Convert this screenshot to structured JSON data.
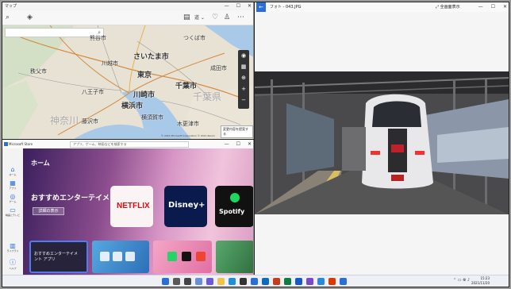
{
  "maps": {
    "title": "マップ",
    "search_icon": "search-icon",
    "labels": {
      "saitama": "さいたま市",
      "tokyo": "東京",
      "chiba": "千葉市",
      "kawasaki": "川崎市",
      "yokohama": "横浜市",
      "chiba_pref": "千葉県",
      "kanagawa": "神奈川",
      "hachioji": "八王子市",
      "chichibu": "秩父市",
      "kumagaya": "熊谷市",
      "tsukuba": "つくば市",
      "narita": "成田市",
      "kisarazu": "木更津市",
      "yokosuka": "横須賀市",
      "fujisawa": "藤沢市",
      "kawagoe": "川越市"
    },
    "feedback_label": "変更内容を提案する",
    "copyright": "© 2021 Microsoft Corporation © 2021 Zenrin"
  },
  "store": {
    "title": "Microsoft Store",
    "search_placeholder": "アプリ、ゲーム、映画などを検索する",
    "nav": {
      "home": "ホーム",
      "apps": "アプリ",
      "games": "ゲーム",
      "movies": "映画とテレビ",
      "library": "ライブラリ",
      "help": "ヘルプ"
    },
    "hero": {
      "home_label": "ホーム",
      "title": "おすすめエンターテイメント アプリ",
      "button": "詳細の表示"
    },
    "tiles": {
      "netflix": "NETFLIX",
      "disney": "Disney+",
      "spotify": "Spotify"
    },
    "cards": {
      "c1": "おすすめエンターテイメ\nント アプリ"
    }
  },
  "photos": {
    "title": "フォト - 043.JPG",
    "fullscreen": "全画面表示"
  },
  "taskbar": {
    "time": "15:23",
    "date": "2021/11/20"
  },
  "colors": {
    "accent": "#2b6fd6",
    "netflix_red": "#e50914",
    "spotify_green": "#1ed760"
  }
}
